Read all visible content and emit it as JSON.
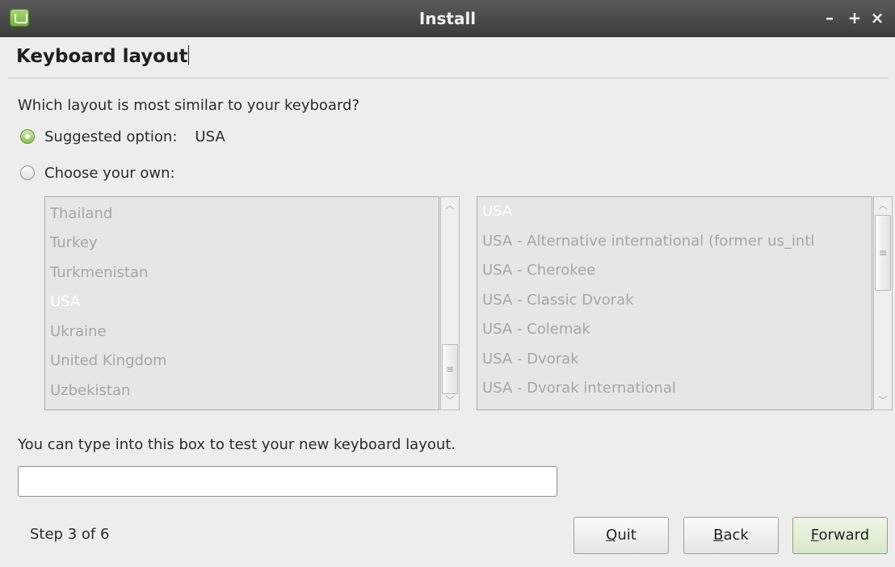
{
  "window": {
    "title": "Install",
    "controls": {
      "minimize": "–",
      "maximize": "+",
      "close": "×"
    }
  },
  "page": {
    "heading": "Keyboard layout",
    "question": "Which layout is most similar to your keyboard?"
  },
  "options": {
    "suggested_label": "Suggested option:",
    "suggested_value": "USA",
    "suggested_selected": true,
    "choose_label": "Choose your own:",
    "choose_selected": false
  },
  "countries": {
    "items": [
      "Thailand",
      "Turkey",
      "Turkmenistan",
      "USA",
      "Ukraine",
      "United Kingdom",
      "Uzbekistan"
    ],
    "selected": "USA"
  },
  "variants": {
    "items": [
      "USA",
      "USA - Alternative international (former us_intl",
      "USA - Cherokee",
      "USA - Classic Dvorak",
      "USA - Colemak",
      "USA - Dvorak",
      "USA - Dvorak international"
    ],
    "selected": "USA"
  },
  "test": {
    "hint": "You can type into this box to test your new keyboard layout.",
    "value": ""
  },
  "footer": {
    "step": "Step 3 of 6",
    "quit": {
      "mnemonic": "Q",
      "rest": "uit"
    },
    "back": {
      "mnemonic": "B",
      "rest": "ack"
    },
    "forward": {
      "mnemonic": "F",
      "rest": "orward"
    }
  },
  "colors": {
    "titlebar": "#4a4a4a",
    "accent_green": "#8cc455",
    "window_bg": "#ededed"
  }
}
